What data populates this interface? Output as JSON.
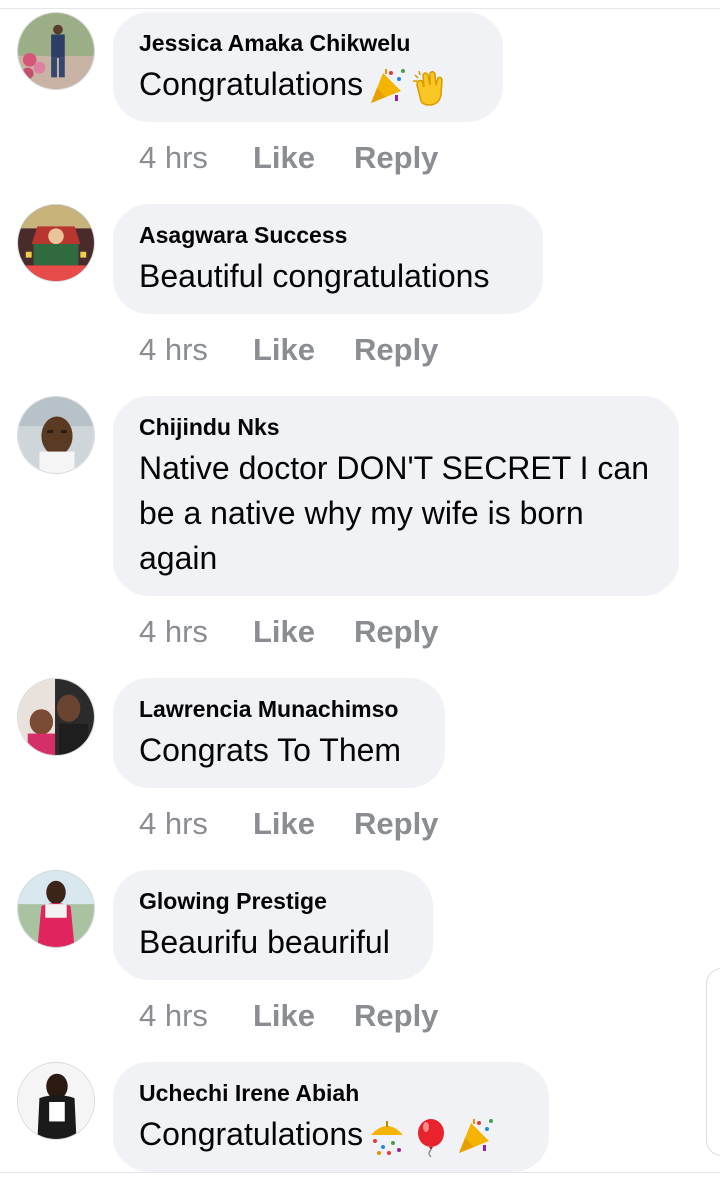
{
  "comments": [
    {
      "author": "Jessica Amaka Chikwelu",
      "text": "Congratulations",
      "emojis": [
        "party-popper-emoji",
        "clapping-hands-emoji"
      ],
      "time": "4 hrs",
      "like": "Like",
      "reply": "Reply"
    },
    {
      "author": "Asagwara Success",
      "text": "Beautiful congratulations",
      "emojis": [],
      "time": "4 hrs",
      "like": "Like",
      "reply": "Reply"
    },
    {
      "author": "Chijindu Nks",
      "text": "Native doctor DON'T SECRET I can be a native why my wife is born again",
      "emojis": [],
      "time": "4 hrs",
      "like": "Like",
      "reply": "Reply"
    },
    {
      "author": "Lawrencia Munachimso",
      "text": "Congrats To Them",
      "emojis": [],
      "time": "4 hrs",
      "like": "Like",
      "reply": "Reply"
    },
    {
      "author": "Glowing Prestige",
      "text": "Beaurifu beauriful",
      "emojis": [],
      "time": "4 hrs",
      "like": "Like",
      "reply": "Reply"
    },
    {
      "author": "Uchechi Irene Abiah",
      "text": "Congratulations",
      "emojis": [
        "confetti-ball-emoji",
        "balloon-emoji",
        "party-popper-emoji"
      ],
      "time": "",
      "like": "",
      "reply": ""
    }
  ],
  "colors": {
    "bubble": "#f0f2f5",
    "author": "#050505",
    "meta": "#8a8d91"
  }
}
